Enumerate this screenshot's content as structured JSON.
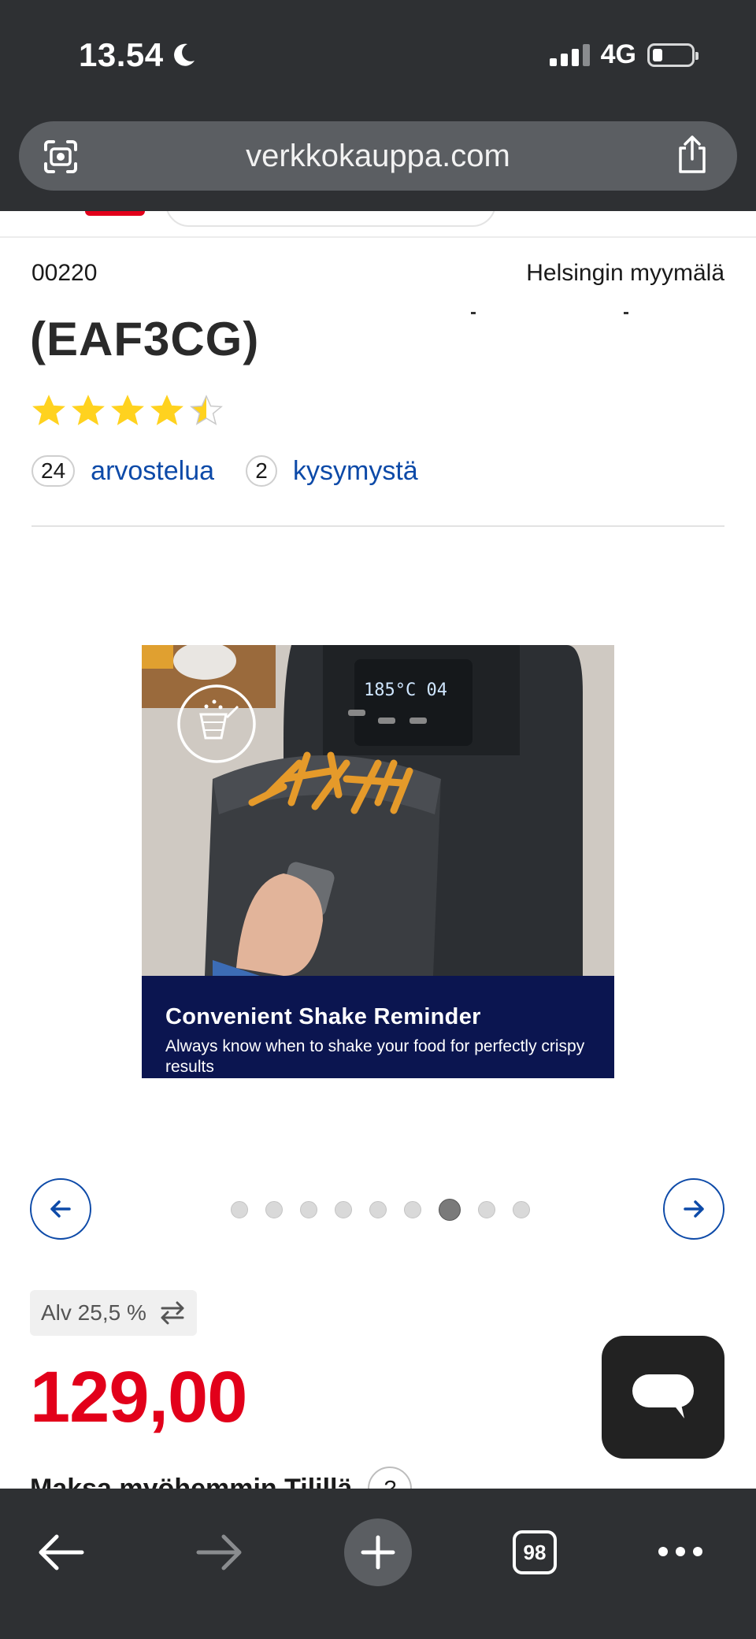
{
  "status_bar": {
    "time": "13.54",
    "network": "4G",
    "signal_bars": 4,
    "signal_bars_active": 3,
    "icons": [
      "moon-icon",
      "signal-icon",
      "battery-icon"
    ]
  },
  "browser": {
    "url": "verkkokauppa.com",
    "open_tabs": "98",
    "icons": [
      "lens-icon",
      "share-icon",
      "back-arrow-icon",
      "forward-arrow-icon",
      "plus-icon",
      "tabs-icon",
      "more-icon"
    ]
  },
  "store": {
    "postal_code": "00220",
    "store_name": "Helsingin myymälä"
  },
  "product": {
    "title": "(EAF3CG)",
    "rating_stars": 4.5,
    "reviews_count": "24",
    "reviews_label": "arvostelua",
    "questions_count": "2",
    "questions_label": "kysymystä"
  },
  "gallery": {
    "promo_title": "Convenient Shake Reminder",
    "promo_text": "Always know when to shake your food for perfectly crispy results",
    "display_readout": "185°C 04",
    "dot_count": 9,
    "active_index": 6,
    "colors": {
      "promo_bg": "#0b1550",
      "arrow": "#0d4aa8"
    }
  },
  "pricing": {
    "vat_label": "Alv 25,5 %",
    "price": "129,00",
    "pay_later_label": "Maksa myöhemmin Tilillä",
    "help_label": "?",
    "colors": {
      "price": "#e2001a"
    }
  },
  "chat": {
    "icon": "chat-bubble-icon"
  }
}
